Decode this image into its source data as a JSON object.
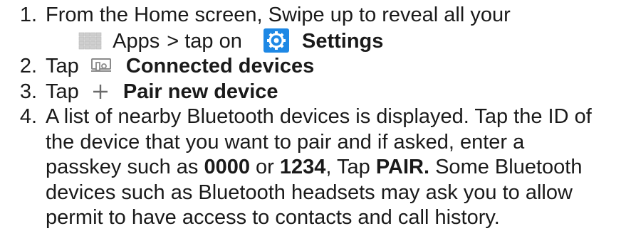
{
  "steps": [
    {
      "number": "1.",
      "line1": "From the Home screen, Swipe up to reveal all your",
      "apps_label": "Apps",
      "tap_on": "> tap on",
      "settings_label": "Settings"
    },
    {
      "number": "2.",
      "tap": "Tap",
      "label": "Connected devices"
    },
    {
      "number": "3.",
      "tap": "Tap",
      "label": "Pair new device"
    },
    {
      "number": "4.",
      "lines": [
        "A list of nearby Bluetooth devices is displayed. Tap the ID of",
        "the device that you want to pair and if asked, enter a"
      ],
      "passkey_intro": "passkey such as",
      "code1": "0000",
      "or": "or",
      "code2": "1234",
      "tap_text": ", Tap",
      "pair": "PAIR.",
      "after_pair": "Some Bluetooth",
      "lines_end": [
        "devices such as Bluetooth headsets may ask you to allow",
        "permit to have access to contacts and call history."
      ]
    }
  ],
  "icons": {
    "apps": "apps-grid-icon",
    "settings": "settings-gear-icon",
    "connected": "connected-devices-icon",
    "plus": "plus-icon"
  },
  "colors": {
    "settings_blue": "#1e88e5",
    "text": "#1a1a1a",
    "icon_gray": "#8a8a8a"
  }
}
